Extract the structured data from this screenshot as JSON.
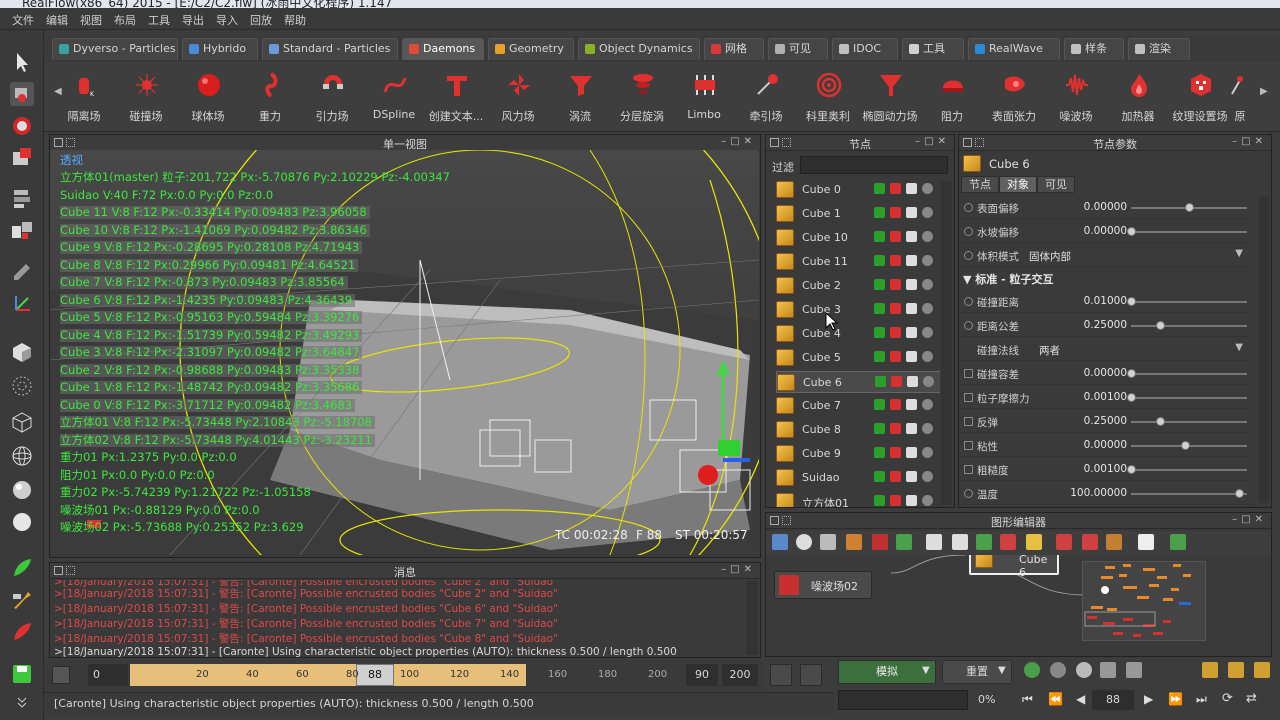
{
  "window": {
    "title": "RealFlow(x86_64) 2015 - [E:/C2/C2.flw] (冰雨中文化程序) 1.147"
  },
  "menu": [
    "文件",
    "编辑",
    "视图",
    "布局",
    "工具",
    "导出",
    "导入",
    "回放",
    "帮助"
  ],
  "tabs": [
    {
      "label": "Dyverso - Particles",
      "color": "#3aa0a0"
    },
    {
      "label": "Hybrido",
      "color": "#4a8ad8"
    },
    {
      "label": "Standard - Particles",
      "color": "#6a9ad8"
    },
    {
      "label": "Daemons",
      "color": "#e04a3a",
      "active": true
    },
    {
      "label": "Geometry",
      "color": "#e6a02c"
    },
    {
      "label": "Object Dynamics",
      "color": "#8ab02a"
    },
    {
      "label": "网格",
      "color": "#d83a3a"
    },
    {
      "label": "可见",
      "color": "#b0b0b0"
    },
    {
      "label": "IDOC",
      "color": "#c0c0c0"
    },
    {
      "label": "工具",
      "color": "#d0d0d0"
    },
    {
      "label": "RealWave",
      "color": "#2a8ad8"
    },
    {
      "label": "样条",
      "color": "#c0c0c0"
    },
    {
      "label": "渲染",
      "color": "#c0c0c0"
    }
  ],
  "ribbon": [
    {
      "label": "隔离场",
      "icon": "isolation-daemon-icon"
    },
    {
      "label": "碰撞场",
      "icon": "collision-daemon-icon"
    },
    {
      "label": "球体场",
      "icon": "sphere-daemon-icon"
    },
    {
      "label": "重力",
      "icon": "gravity-daemon-icon"
    },
    {
      "label": "引力场",
      "icon": "attractor-daemon-icon"
    },
    {
      "label": "DSpline",
      "icon": "dspline-daemon-icon"
    },
    {
      "label": "创建文本...",
      "icon": "text-daemon-icon"
    },
    {
      "label": "风力场",
      "icon": "wind-daemon-icon"
    },
    {
      "label": "涡流",
      "icon": "vortex-daemon-icon"
    },
    {
      "label": "分层旋涡",
      "icon": "layered-vortex-icon"
    },
    {
      "label": "Limbo",
      "icon": "limbo-daemon-icon"
    },
    {
      "label": "牵引场",
      "icon": "traction-daemon-icon"
    },
    {
      "label": "科里奥利",
      "icon": "coriolis-daemon-icon"
    },
    {
      "label": "椭圆动力场",
      "icon": "elliptic-daemon-icon"
    },
    {
      "label": "阻力",
      "icon": "drag-daemon-icon"
    },
    {
      "label": "表面张力",
      "icon": "surface-tension-icon"
    },
    {
      "label": "噪波场",
      "icon": "noise-daemon-icon"
    },
    {
      "label": "加热器",
      "icon": "heater-daemon-icon"
    },
    {
      "label": "纹理设置场",
      "icon": "texture-daemon-icon"
    },
    {
      "label": "原",
      "icon": "more-daemon-icon"
    }
  ],
  "viewport": {
    "title": "单一视图",
    "camera": "透视",
    "overlay": [
      {
        "t": "立方体01(master) 粒子:201,722 Px:-5.70876 Py:2.10229 Pz:-4.00347",
        "hl": false
      },
      {
        "t": "Suidao V:40 F:72 Px:0.0 Py:0.0 Pz:0.0",
        "hl": false
      },
      {
        "t": "Cube 11 V:8 F:12 Px:-0.33414 Py:0.09483 Pz:3.96058",
        "hl": true
      },
      {
        "t": "Cube 10 V:8 F:12 Px:-1.41069 Py:0.09482 Pz:3.86346",
        "hl": true
      },
      {
        "t": "Cube 9 V:8 F:12 Px:-0.28695 Py:0.28108 Pz:4.71943",
        "hl": true
      },
      {
        "t": "Cube 8 V:8 F:12 Px:0.29966 Py:0.09481 Pz:4.64521",
        "hl": true
      },
      {
        "t": "Cube 7 V:8 F:12 Px:-0.873 Py:0.09483 Pz:3.85564",
        "hl": true
      },
      {
        "t": "Cube 6 V:8 F:12 Px:-1.4235 Py:0.09483 Pz:4.36439",
        "hl": true
      },
      {
        "t": "Cube 5 V:8 F:12 Px:-0.95163 Py:0.59484 Pz:3.39276",
        "hl": true
      },
      {
        "t": "Cube 4 V:8 F:12 Px:-1.51739 Py:0.59482 Pz:3.49293",
        "hl": true
      },
      {
        "t": "Cube 3 V:8 F:12 Px:-2.31097 Py:0.09482 Pz:3.64847",
        "hl": true
      },
      {
        "t": "Cube 2 V:8 F:12 Px:-0.98688 Py:0.09483 Pz:3.35338",
        "hl": true
      },
      {
        "t": "Cube 1 V:8 F:12 Px:-1.48742 Py:0.09482 Pz:3.35686",
        "hl": true
      },
      {
        "t": "Cube 0 V:8 F:12 Px:-3.71712 Py:0.09482 Pz:3.4683",
        "hl": true
      },
      {
        "t": "立方体01 V:8 F:12 Px:-5.73448 Py:2.10843 Pz:-5.18708",
        "hl": true
      },
      {
        "t": "立方体02 V:8 F:12 Px:-5.73448 Py:4.01443 Pz:-3.23211",
        "hl": true
      },
      {
        "t": "重力01 Px:1.2375 Py:0.0 Pz:0.0",
        "hl": false
      },
      {
        "t": "阻力01 Px:0.0 Py:0.0 Pz:0.0",
        "hl": false
      },
      {
        "t": "重力02 Px:-5.74239 Py:1.21722 Pz:-1.05158",
        "hl": false
      },
      {
        "t": "噪波场01 Px:-0.88129 Py:0.0 Pz:0.0",
        "hl": false
      },
      {
        "t": "噪波场02 Px:-5.73688 Py:0.25352 Pz:3.629",
        "hl": false
      }
    ],
    "tc": "TC 00:02:28",
    "frame": "F 88",
    "st": "ST 00:20:57"
  },
  "messages": {
    "title": "消息",
    "lines": [
      {
        "t": ">[18/January/2018 15:07:31] - 警告: [Caronte] Possible encrusted bodies \"Cube 2\" and \"Suidao\"",
        "w": false
      },
      {
        "t": ">[18/January/2018 15:07:31] - 警告: [Caronte] Possible encrusted bodies \"Cube 6\" and \"Suidao\"",
        "w": false
      },
      {
        "t": ">[18/January/2018 15:07:31] - 警告: [Caronte] Possible encrusted bodies \"Cube 7\" and \"Suidao\"",
        "w": false
      },
      {
        "t": ">[18/January/2018 15:07:31] - 警告: [Caronte] Possible encrusted bodies \"Cube 8\" and \"Suidao\"",
        "w": false
      },
      {
        "t": ">[18/January/2018 15:07:31] - [Caronte] Using characteristic object properties (AUTO): thickness 0.500 / length 0.500",
        "w": true
      }
    ]
  },
  "timeline": {
    "start": "0",
    "ticks": [
      "20",
      "40",
      "60",
      "80",
      "100",
      "120",
      "140",
      "160",
      "180",
      "200"
    ],
    "current": "88",
    "range_end": "90",
    "end": "200",
    "progress": 0.44
  },
  "status": {
    "text": "[Caronte] Using characteristic object properties (AUTO): thickness 0.500 / length 0.500"
  },
  "nodes": {
    "title": "节点",
    "filter_label": "过滤",
    "filter_value": "",
    "items": [
      "Cube 0",
      "Cube 1",
      "Cube 10",
      "Cube 11",
      "Cube 2",
      "Cube 3",
      "Cube 4",
      "Cube 5",
      "Cube 6",
      "Cube 7",
      "Cube 8",
      "Cube 9",
      "Suidao",
      "立方体01"
    ],
    "selected": "Cube 6"
  },
  "params": {
    "title": "节点参数",
    "object": "Cube 6",
    "tabs": [
      "节点",
      "对象",
      "可见"
    ],
    "active_tab": "对象",
    "rows": [
      {
        "label": "表面偏移",
        "value": "0.00000",
        "slider": 0.5
      },
      {
        "label": "水坡偏移",
        "value": "0.00000",
        "slider": 0.0
      },
      {
        "label": "体积模式",
        "value": "固体内部",
        "dropdown": true
      },
      {
        "section": "▼ 标准 - 粒子交互"
      },
      {
        "label": "碰撞距离",
        "value": "0.01000",
        "slider": 0.0
      },
      {
        "label": "距离公差",
        "value": "0.25000",
        "slider": 0.25
      },
      {
        "label": "碰撞法线",
        "value": "两者",
        "dropdown": true
      },
      {
        "label": "碰撞容差",
        "value": "0.00000",
        "slider": 0.0
      },
      {
        "label": "粒子摩擦力",
        "value": "0.00100",
        "slider": 0.0
      },
      {
        "label": "反弹",
        "value": "0.25000",
        "slider": 0.25
      },
      {
        "label": "粘性",
        "value": "0.00000",
        "slider": 0.5
      },
      {
        "label": "粗糙度",
        "value": "0.00100",
        "slider": 0.0
      },
      {
        "label": "温度",
        "value": "100.00000",
        "slider": 1.0
      }
    ]
  },
  "graph": {
    "title": "图形编辑器",
    "node_a": "噪波场02",
    "node_b": "Cube 6"
  },
  "sim": {
    "simulate_label": "模拟",
    "reset_label": "重置",
    "percent": "0%",
    "frame": "88"
  }
}
